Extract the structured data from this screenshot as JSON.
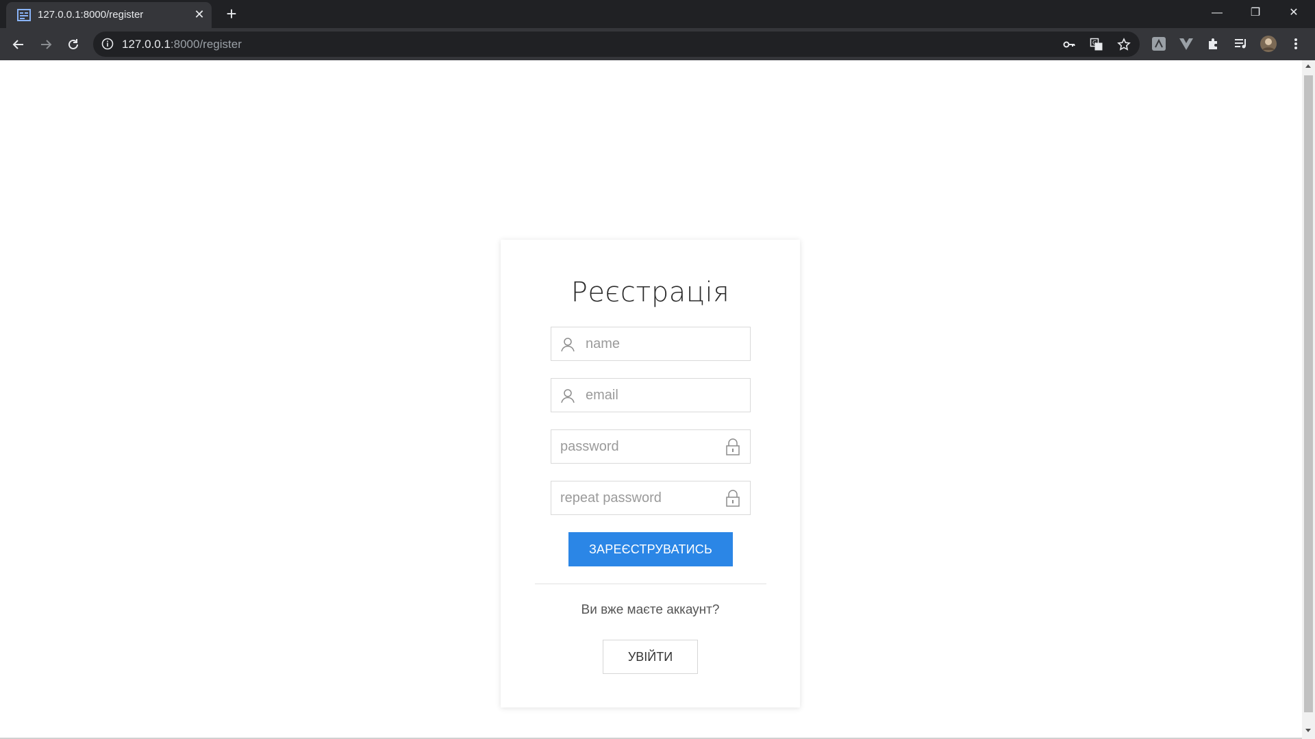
{
  "browser": {
    "tab_title": "127.0.0.1:8000/register",
    "url_host": "127.0.0.1",
    "url_rest": ":8000/register",
    "window_controls": {
      "minimize": "—",
      "maximize": "❐",
      "close": "✕"
    },
    "icons": [
      "key-icon",
      "translate-icon",
      "star-icon",
      "extension-1-icon",
      "vue-devtools-icon",
      "puzzle-icon",
      "media-icon",
      "profile-avatar",
      "more-menu-icon"
    ]
  },
  "form": {
    "title": "Реєстрація",
    "name_placeholder": "name",
    "email_placeholder": "email",
    "password_placeholder": "password",
    "repeat_password_placeholder": "repeat password",
    "submit_label": "ЗАРЕЄСТРУВАТИСЬ",
    "have_account_text": "Ви вже маєте аккаунт?",
    "login_label": "УВІЙТИ"
  },
  "colors": {
    "primary": "#2b86e6",
    "chrome_dark": "#202124",
    "chrome_tab": "#35363a"
  }
}
